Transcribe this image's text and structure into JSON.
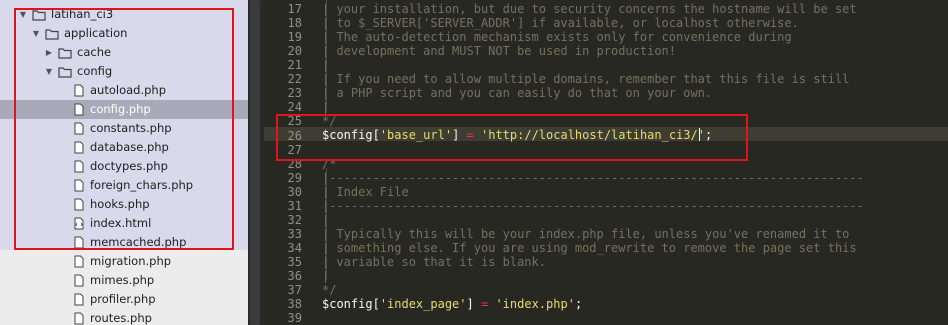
{
  "sidebar": {
    "items": [
      {
        "label": "latihan_ci3",
        "type": "folder",
        "depth": 0,
        "expanded": true
      },
      {
        "label": "application",
        "type": "folder",
        "depth": 1,
        "expanded": true
      },
      {
        "label": "cache",
        "type": "folder",
        "depth": 2,
        "expanded": false
      },
      {
        "label": "config",
        "type": "folder",
        "depth": 2,
        "expanded": true
      },
      {
        "label": "autoload.php",
        "type": "file",
        "depth": 3
      },
      {
        "label": "config.php",
        "type": "file",
        "depth": 3,
        "selected": true
      },
      {
        "label": "constants.php",
        "type": "file",
        "depth": 3
      },
      {
        "label": "database.php",
        "type": "file",
        "depth": 3
      },
      {
        "label": "doctypes.php",
        "type": "file",
        "depth": 3
      },
      {
        "label": "foreign_chars.php",
        "type": "file",
        "depth": 3
      },
      {
        "label": "hooks.php",
        "type": "file",
        "depth": 3
      },
      {
        "label": "index.html",
        "type": "file-html",
        "depth": 3
      },
      {
        "label": "memcached.php",
        "type": "file",
        "depth": 3
      },
      {
        "label": "migration.php",
        "type": "file",
        "depth": 3
      },
      {
        "label": "mimes.php",
        "type": "file",
        "depth": 3
      },
      {
        "label": "profiler.php",
        "type": "file",
        "depth": 3
      },
      {
        "label": "routes.php",
        "type": "file",
        "depth": 3
      }
    ]
  },
  "editor": {
    "lines": [
      {
        "num": "17",
        "text": "| your installation, but due to security concerns the hostname will be set"
      },
      {
        "num": "18",
        "text": "| to $_SERVER['SERVER_ADDR'] if available, or localhost otherwise."
      },
      {
        "num": "19",
        "text": "| The auto-detection mechanism exists only for convenience during"
      },
      {
        "num": "20",
        "text": "| development and MUST NOT be used in production!"
      },
      {
        "num": "21",
        "text": "|"
      },
      {
        "num": "22",
        "text": "| If you need to allow multiple domains, remember that this file is still"
      },
      {
        "num": "23",
        "text": "| a PHP script and you can easily do that on your own."
      },
      {
        "num": "24",
        "text": "|"
      },
      {
        "num": "25",
        "text": "*/"
      },
      {
        "num": "26",
        "text": ""
      },
      {
        "num": "27",
        "text": ""
      },
      {
        "num": "28",
        "text": "/*"
      },
      {
        "num": "29",
        "text": "|--------------------------------------------------------------------------"
      },
      {
        "num": "30",
        "text": "| Index File"
      },
      {
        "num": "31",
        "text": "|--------------------------------------------------------------------------"
      },
      {
        "num": "32",
        "text": "|"
      },
      {
        "num": "33",
        "text": "| Typically this will be your index.php file, unless you've renamed it to"
      },
      {
        "num": "34",
        "text": "| something else. If you are using mod_rewrite to remove the page set this"
      },
      {
        "num": "35",
        "text": "| variable so that it is blank."
      },
      {
        "num": "36",
        "text": "|"
      },
      {
        "num": "37",
        "text": "*/"
      },
      {
        "num": "38",
        "text": ""
      },
      {
        "num": "39",
        "text": ""
      }
    ],
    "base_url_line": {
      "var": "$config",
      "key": "'base_url'",
      "op": "=",
      "value": "'http://localhost/latihan_ci3/'",
      "end": ";"
    },
    "index_page_line": {
      "var": "$config",
      "key": "'index_page'",
      "op": "=",
      "value": "'index.php'",
      "end": ";"
    }
  }
}
